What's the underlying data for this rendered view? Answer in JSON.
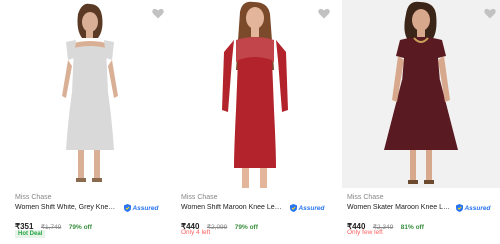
{
  "products": [
    {
      "brand": "Miss Chase",
      "title": "Women Shift White, Grey Knee L...",
      "assured_label": "Assured",
      "price": "₹351",
      "mrp": "₹1,749",
      "discount": "79% off",
      "tag": "Hot Deal",
      "image_icon": "dress-photo-white-grey",
      "colors": {
        "dress": "#d9d9d9",
        "skin": "#d9b096",
        "hair": "#5a3a24"
      }
    },
    {
      "brand": "Miss Chase",
      "title": "Women Shift Maroon Knee Leng...",
      "assured_label": "Assured",
      "price": "₹440",
      "mrp": "₹2,099",
      "discount": "79% off",
      "stock": "Only 4 left",
      "image_icon": "dress-photo-maroon-shift",
      "colors": {
        "dress": "#b3232b",
        "skin": "#e3b59a",
        "hair": "#7a4a2a"
      }
    },
    {
      "brand": "Miss Chase",
      "title": "Women Skater Maroon Knee Len...",
      "assured_label": "Assured",
      "price": "₹440",
      "mrp": "₹2,349",
      "discount": "81% off",
      "stock": "Only few left",
      "image_icon": "dress-photo-maroon-skater",
      "colors": {
        "dress": "#5a1a22",
        "skin": "#d8a88c",
        "hair": "#3b2418"
      }
    }
  ],
  "accent_colors": {
    "discount": "#388e3c",
    "assured": "#2874f0",
    "stock": "#ff6161",
    "wishlist": "#c2c2c2"
  }
}
